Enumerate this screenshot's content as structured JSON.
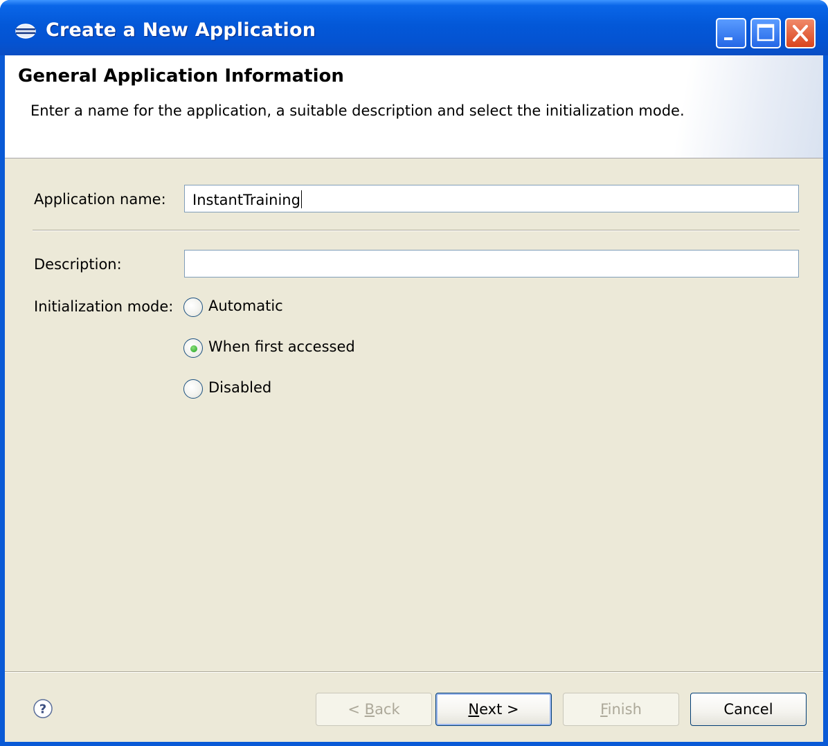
{
  "window": {
    "title": "Create a New Application",
    "icon": "application-globe-icon",
    "controls": [
      "minimize-icon",
      "maximize-icon",
      "close-icon"
    ]
  },
  "header": {
    "title": "General Application Information",
    "description": "Enter a name for the application, a suitable description and select the initialization mode."
  },
  "form": {
    "name_label": "Application name:",
    "name_value": "InstantTraining",
    "description_label": "Description:",
    "description_value": "",
    "init_mode_label": "Initialization mode:",
    "init_modes": [
      {
        "label": "Automatic",
        "selected": false
      },
      {
        "label": "When first accessed",
        "selected": true
      },
      {
        "label": "Disabled",
        "selected": false
      }
    ]
  },
  "footer": {
    "help_icon": "help-icon",
    "back": {
      "prefix": "< ",
      "mnemonic": "B",
      "rest": "ack",
      "enabled": false
    },
    "next": {
      "mnemonic": "N",
      "rest": "ext >",
      "enabled": true
    },
    "finish": {
      "mnemonic": "F",
      "rest": "inish",
      "enabled": false
    },
    "cancel": {
      "label": "Cancel",
      "enabled": true
    }
  },
  "colors": {
    "titlebar": "#0358d8",
    "dialog_bg": "#ece9d8",
    "radio_selected": "#21a121",
    "input_border": "#7f9db9"
  }
}
